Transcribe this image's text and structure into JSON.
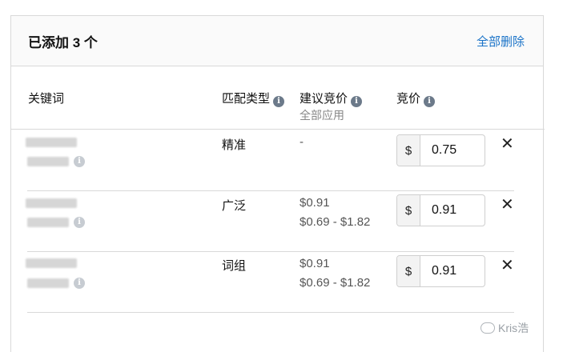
{
  "header": {
    "added_label": "已添加 3 个",
    "delete_all": "全部删除"
  },
  "columns": {
    "keyword": "关键词",
    "match_type": "匹配类型",
    "suggested_bid": "建议竞价",
    "apply_all": "全部应用",
    "bid": "竞价"
  },
  "rows": [
    {
      "match_type": "精准",
      "suggested": "-",
      "range": "",
      "currency": "$",
      "bid": "0.75"
    },
    {
      "match_type": "广泛",
      "suggested": "$0.91",
      "range": "$0.69 - $1.82",
      "currency": "$",
      "bid": "0.91"
    },
    {
      "match_type": "词组",
      "suggested": "$0.91",
      "range": "$0.69 - $1.82",
      "currency": "$",
      "bid": "0.91"
    }
  ],
  "remove_symbol": "✕",
  "info_symbol": "i",
  "watermark": "Kris浩",
  "colors": {
    "link": "#1a73c8",
    "border": "#d9d9d9",
    "info_icon": "#6c7a8a"
  }
}
